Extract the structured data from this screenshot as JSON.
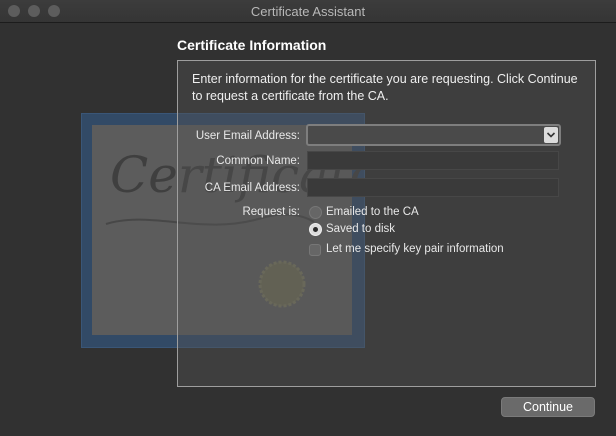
{
  "window": {
    "title": "Certificate Assistant"
  },
  "heading": "Certificate Information",
  "intro": "Enter information for the certificate you are requesting. Click Continue to request a certificate from the CA.",
  "form": {
    "user_email": {
      "label": "User Email Address:",
      "value": ""
    },
    "common_name": {
      "label": "Common Name:",
      "value": ""
    },
    "ca_email": {
      "label": "CA Email Address:",
      "value": ""
    },
    "request_is": {
      "label": "Request is:",
      "options": [
        {
          "label": "Emailed to the CA",
          "selected": false
        },
        {
          "label": "Saved to disk",
          "selected": true
        }
      ]
    },
    "key_pair_checkbox": {
      "label": "Let me specify key pair information",
      "checked": false
    }
  },
  "buttons": {
    "continue": "Continue"
  },
  "artwork": {
    "word": "Certificate"
  }
}
